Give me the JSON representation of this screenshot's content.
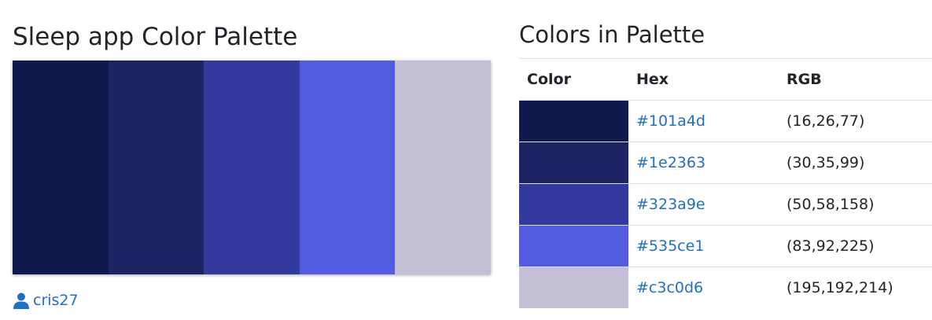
{
  "palette": {
    "title": "Sleep app Color Palette",
    "author": "cris27",
    "colors": [
      "#101a4d",
      "#1e2363",
      "#323a9e",
      "#535ce1",
      "#c3c0d6"
    ]
  },
  "table": {
    "title": "Colors in Palette",
    "headers": [
      "Color",
      "Hex",
      "RGB"
    ],
    "rows": [
      {
        "color": "#101a4d",
        "hex": "#101a4d",
        "rgb": "(16,26,77)"
      },
      {
        "color": "#1e2363",
        "hex": "#1e2363",
        "rgb": "(30,35,99)"
      },
      {
        "color": "#323a9e",
        "hex": "#323a9e",
        "rgb": "(50,58,158)"
      },
      {
        "color": "#535ce1",
        "hex": "#535ce1",
        "rgb": "(83,92,225)"
      },
      {
        "color": "#c3c0d6",
        "hex": "#c3c0d6",
        "rgb": "(195,192,214)"
      }
    ]
  },
  "icons": {
    "author": "user-icon"
  },
  "accent": {
    "link": "#1f6fc2"
  }
}
